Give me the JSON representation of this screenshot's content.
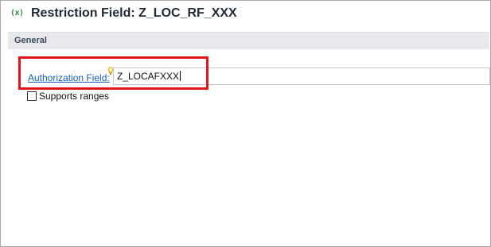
{
  "header": {
    "icon": "variable-icon",
    "icon_text": "(x)",
    "title": "Restriction Field: Z_LOC_RF_XXX",
    "icon_color": "#2e8b3a"
  },
  "section": {
    "title": "General"
  },
  "form": {
    "authorization_field": {
      "label": "Authorization Field:",
      "value": "Z_LOCAFXXX",
      "link_color": "#1660b8",
      "hint_icon": "lightbulb-icon"
    },
    "supports_ranges": {
      "label": "Supports ranges",
      "checked": false
    }
  },
  "annotation": {
    "highlight_color": "#e0161c"
  }
}
